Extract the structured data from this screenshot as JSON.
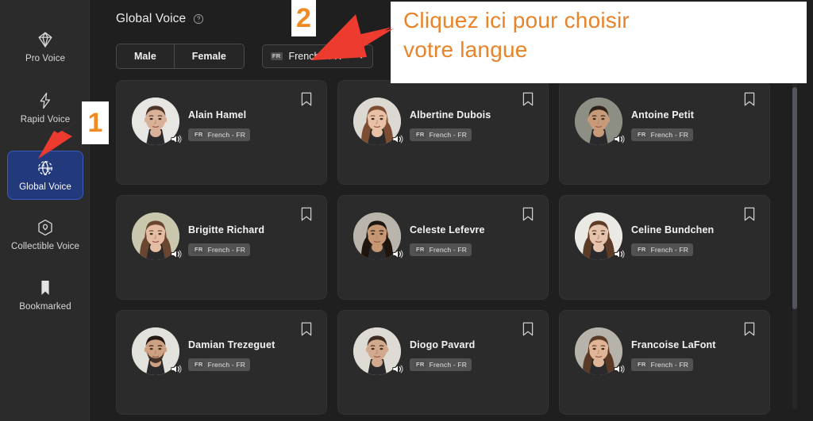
{
  "app": {
    "background": "#1f1f1f",
    "accent_blue": "#22397c",
    "annotation_orange": "#e8832a",
    "arrow_red": "#ee3b2f"
  },
  "sidebar": {
    "items": [
      {
        "id": "pro-voice",
        "label": "Pro Voice",
        "icon": "diamond-icon",
        "active": false
      },
      {
        "id": "rapid-voice",
        "label": "Rapid Voice",
        "icon": "lightning-icon",
        "active": false
      },
      {
        "id": "global-voice",
        "label": "Global Voice",
        "icon": "translate-globe-icon",
        "active": true
      },
      {
        "id": "collectible-voice",
        "label": "Collectible Voice",
        "icon": "cube-shield-icon",
        "active": false
      },
      {
        "id": "bookmarked",
        "label": "Bookmarked",
        "icon": "bookmark-icon",
        "active": false
      }
    ]
  },
  "header": {
    "title": "Global Voice",
    "help_icon": "question-circle-icon"
  },
  "controls": {
    "gender_toggle": {
      "options": [
        "Male",
        "Female"
      ],
      "selected": null
    },
    "language_select": {
      "flag_code": "FR",
      "value": "French - FR",
      "caret_icon": "chevron-down-icon"
    }
  },
  "voices": [
    {
      "name": "Alain Hamel",
      "language": "French - FR",
      "flag_code": "FR",
      "bookmarked": false,
      "avatar": "male-1"
    },
    {
      "name": "Albertine Dubois",
      "language": "French - FR",
      "flag_code": "FR",
      "bookmarked": false,
      "avatar": "female-1"
    },
    {
      "name": "Antoine Petit",
      "language": "French - FR",
      "flag_code": "FR",
      "bookmarked": false,
      "avatar": "male-2"
    },
    {
      "name": "Brigitte Richard",
      "language": "French - FR",
      "flag_code": "FR",
      "bookmarked": false,
      "avatar": "female-2"
    },
    {
      "name": "Celeste Lefevre",
      "language": "French - FR",
      "flag_code": "FR",
      "bookmarked": false,
      "avatar": "female-3"
    },
    {
      "name": "Celine Bundchen",
      "language": "French - FR",
      "flag_code": "FR",
      "bookmarked": false,
      "avatar": "female-4"
    },
    {
      "name": "Damian Trezeguet",
      "language": "French - FR",
      "flag_code": "FR",
      "bookmarked": false,
      "avatar": "male-3"
    },
    {
      "name": "Diogo Pavard",
      "language": "French - FR",
      "flag_code": "FR",
      "bookmarked": false,
      "avatar": "male-4"
    },
    {
      "name": "Francoise LaFont",
      "language": "French - FR",
      "flag_code": "FR",
      "bookmarked": false,
      "avatar": "female-5"
    }
  ],
  "annotations": {
    "note_line1": "Cliquez ici pour choisir",
    "note_line2": "votre langue",
    "step_one": "1",
    "step_two": "2"
  }
}
